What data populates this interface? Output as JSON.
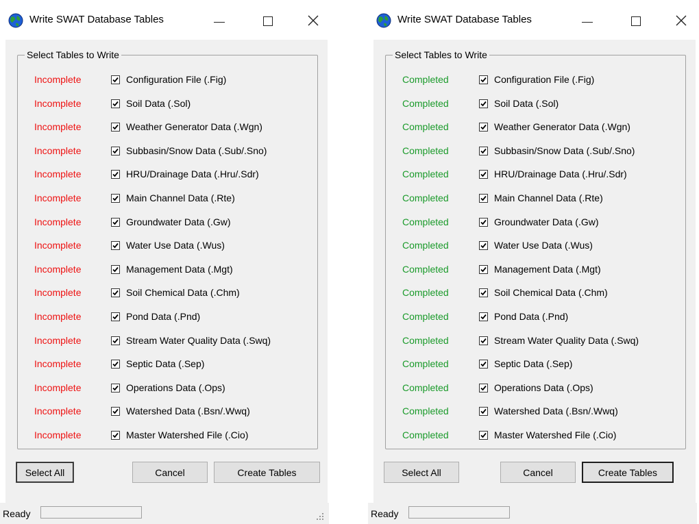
{
  "left_window": {
    "title": "Write SWAT Database Tables",
    "group_title": "Select Tables to Write",
    "rows": [
      {
        "status": "Incomplete",
        "label": "Configuration File (.Fig)",
        "checked": true
      },
      {
        "status": "Incomplete",
        "label": "Soil Data (.Sol)",
        "checked": true
      },
      {
        "status": "Incomplete",
        "label": "Weather Generator Data (.Wgn)",
        "checked": true
      },
      {
        "status": "Incomplete",
        "label": "Subbasin/Snow Data (.Sub/.Sno)",
        "checked": true
      },
      {
        "status": "Incomplete",
        "label": "HRU/Drainage Data (.Hru/.Sdr)",
        "checked": true
      },
      {
        "status": "Incomplete",
        "label": "Main Channel Data (.Rte)",
        "checked": true
      },
      {
        "status": "Incomplete",
        "label": "Groundwater Data (.Gw)",
        "checked": true
      },
      {
        "status": "Incomplete",
        "label": "Water Use Data (.Wus)",
        "checked": true
      },
      {
        "status": "Incomplete",
        "label": "Management Data (.Mgt)",
        "checked": true
      },
      {
        "status": "Incomplete",
        "label": "Soil Chemical Data (.Chm)",
        "checked": true
      },
      {
        "status": "Incomplete",
        "label": "Pond Data (.Pnd)",
        "checked": true
      },
      {
        "status": "Incomplete",
        "label": "Stream Water Quality Data (.Swq)",
        "checked": true
      },
      {
        "status": "Incomplete",
        "label": "Septic Data (.Sep)",
        "checked": true
      },
      {
        "status": "Incomplete",
        "label": "Operations Data (.Ops)",
        "checked": true
      },
      {
        "status": "Incomplete",
        "label": "Watershed Data (.Bsn/.Wwq)",
        "checked": true
      },
      {
        "status": "Incomplete",
        "label": "Master Watershed File (.Cio)",
        "checked": true
      }
    ],
    "buttons": {
      "select_all": "Select All",
      "cancel": "Cancel",
      "create_tables": "Create Tables"
    },
    "status_text": "Ready"
  },
  "right_window": {
    "title": "Write SWAT Database Tables",
    "group_title": "Select Tables to Write",
    "rows": [
      {
        "status": "Completed",
        "label": "Configuration File (.Fig)",
        "checked": true
      },
      {
        "status": "Completed",
        "label": "Soil Data (.Sol)",
        "checked": true
      },
      {
        "status": "Completed",
        "label": "Weather Generator Data (.Wgn)",
        "checked": true
      },
      {
        "status": "Completed",
        "label": "Subbasin/Snow Data (.Sub/.Sno)",
        "checked": true
      },
      {
        "status": "Completed",
        "label": "HRU/Drainage Data (.Hru/.Sdr)",
        "checked": true
      },
      {
        "status": "Completed",
        "label": "Main Channel Data (.Rte)",
        "checked": true
      },
      {
        "status": "Completed",
        "label": "Groundwater Data (.Gw)",
        "checked": true
      },
      {
        "status": "Completed",
        "label": "Water Use Data (.Wus)",
        "checked": true
      },
      {
        "status": "Completed",
        "label": "Management Data (.Mgt)",
        "checked": true
      },
      {
        "status": "Completed",
        "label": "Soil Chemical Data (.Chm)",
        "checked": true
      },
      {
        "status": "Completed",
        "label": "Pond Data (.Pnd)",
        "checked": true
      },
      {
        "status": "Completed",
        "label": "Stream Water Quality Data (.Swq)",
        "checked": true
      },
      {
        "status": "Completed",
        "label": "Septic Data (.Sep)",
        "checked": true
      },
      {
        "status": "Completed",
        "label": "Operations Data (.Ops)",
        "checked": true
      },
      {
        "status": "Completed",
        "label": "Watershed Data (.Bsn/.Wwq)",
        "checked": true
      },
      {
        "status": "Completed",
        "label": "Master Watershed File (.Cio)",
        "checked": true
      }
    ],
    "buttons": {
      "select_all": "Select All",
      "cancel": "Cancel",
      "create_tables": "Create Tables"
    },
    "status_text": "Ready"
  },
  "colors": {
    "incomplete": "#ee1111",
    "completed": "#1a9a2a"
  },
  "icons": {
    "app": "globe-icon",
    "minimize": "minimize-icon",
    "maximize": "maximize-icon",
    "close": "close-icon",
    "check": "checkmark-icon",
    "grip": "resize-grip-icon"
  }
}
